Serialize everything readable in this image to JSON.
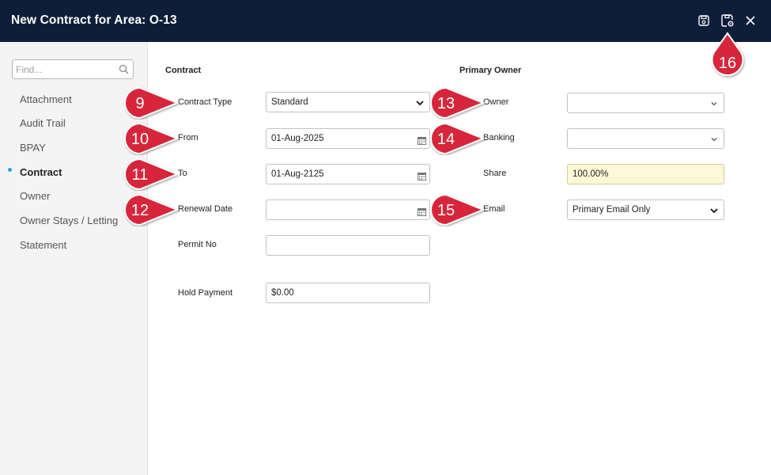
{
  "window": {
    "title": "New Contract for Area: O-13"
  },
  "sidebar": {
    "search": {
      "placeholder": "Find..."
    },
    "items": [
      {
        "label": "Attachment",
        "active": false
      },
      {
        "label": "Audit Trail",
        "active": false
      },
      {
        "label": "BPAY",
        "active": false
      },
      {
        "label": "Contract",
        "active": true
      },
      {
        "label": "Owner",
        "active": false
      },
      {
        "label": "Owner Stays / Letting",
        "active": false
      },
      {
        "label": "Statement",
        "active": false
      }
    ]
  },
  "contract": {
    "section_title": "Contract",
    "contract_type": {
      "label": "Contract Type",
      "value": "Standard"
    },
    "from": {
      "label": "From",
      "value": "01-Aug-2025"
    },
    "to": {
      "label": "To",
      "value": "01-Aug-2125"
    },
    "renewal_date": {
      "label": "Renewal Date",
      "value": ""
    },
    "permit_no": {
      "label": "Permit No",
      "value": ""
    },
    "hold_payment": {
      "label": "Hold Payment",
      "value": "$0.00"
    }
  },
  "primary_owner": {
    "section_title": "Primary Owner",
    "owner": {
      "label": "Owner",
      "value": ""
    },
    "banking": {
      "label": "Banking",
      "value": ""
    },
    "share": {
      "label": "Share",
      "value": "100.00%"
    },
    "email": {
      "label": "Email",
      "value": "Primary Email Only"
    }
  },
  "callouts": [
    "9",
    "10",
    "11",
    "12",
    "13",
    "14",
    "15",
    "16"
  ],
  "colors": {
    "titlebar": "#0f1e38",
    "callout": "#d7273a",
    "active_dot": "#27a3d8",
    "share_field": "#fff8d6"
  },
  "icons": {
    "save": "save-icon",
    "save_settings": "save-settings-icon",
    "close": "close-icon",
    "search": "search-icon",
    "calendar": "calendar-icon",
    "dropdown": "chevron-down-icon"
  }
}
